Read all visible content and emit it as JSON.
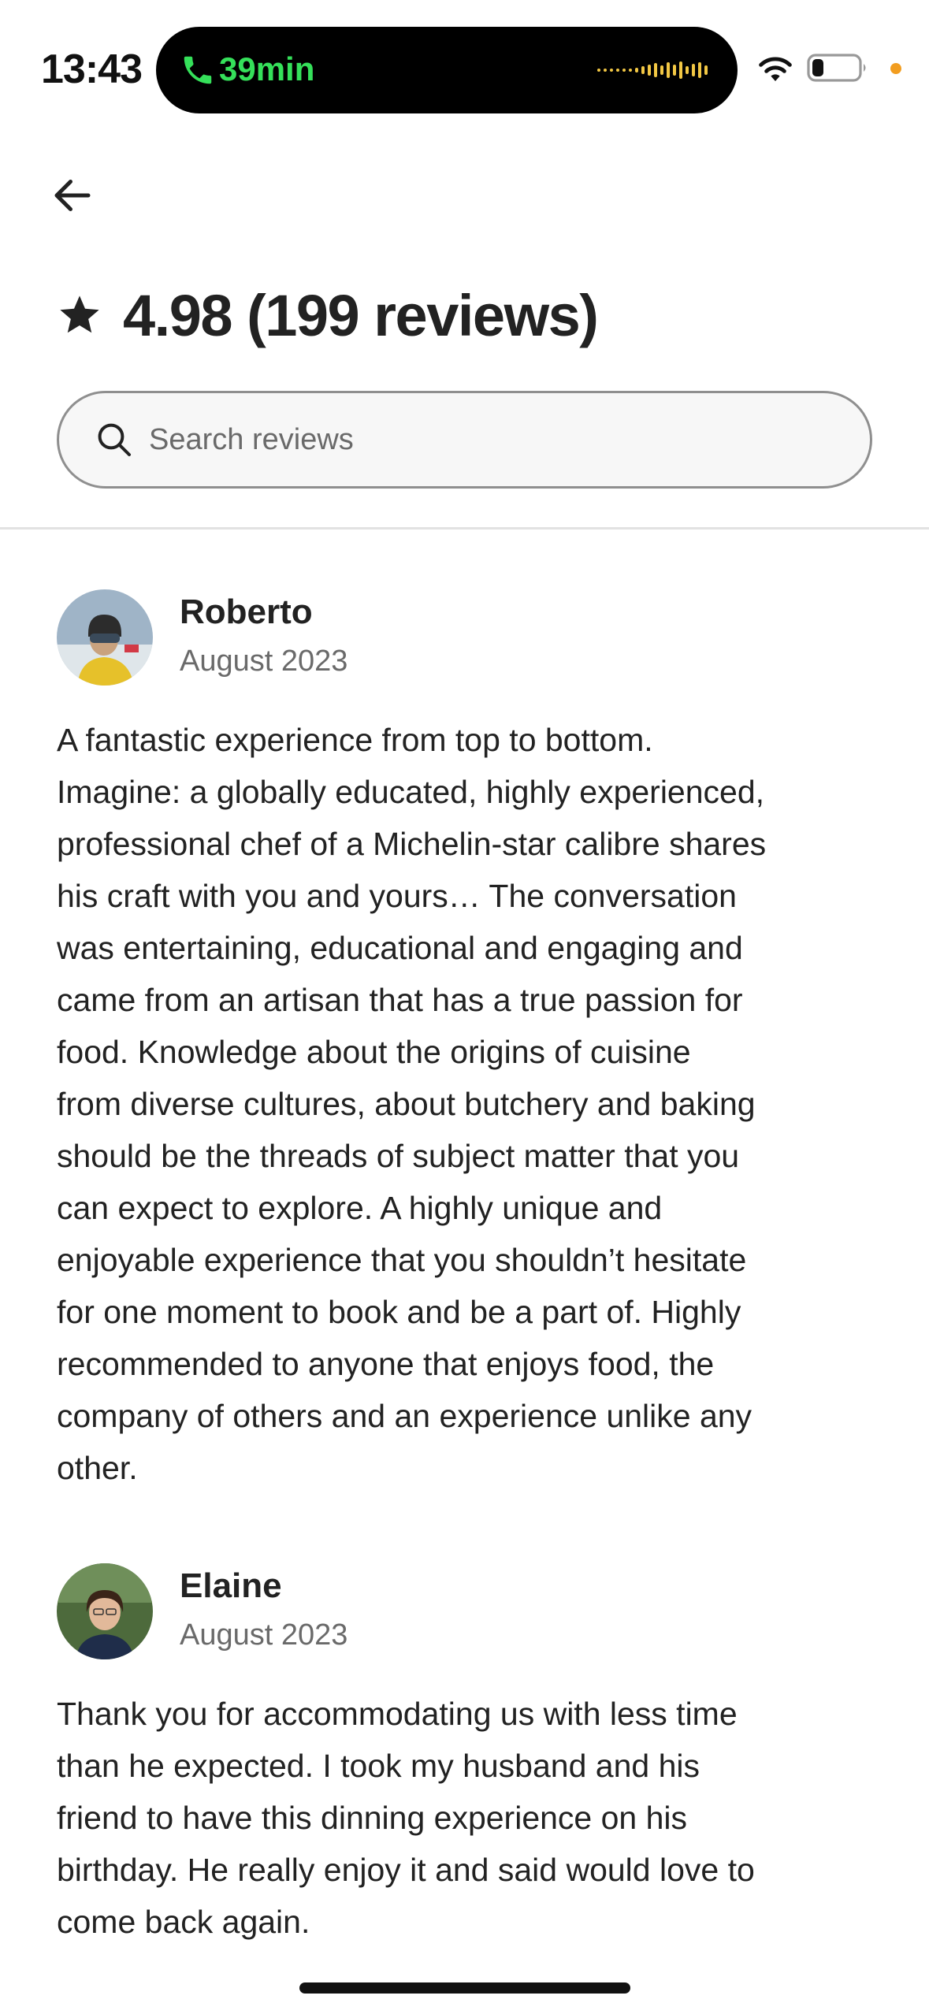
{
  "status_bar": {
    "time": "13:43",
    "call_duration": "39min",
    "icons": [
      "phone-icon",
      "waveform-icon",
      "wifi-icon",
      "battery-icon",
      "orange-dot-indicator"
    ],
    "colors": {
      "call": "#35e05a",
      "waveform": "#f2c744",
      "indicator": "#f29d1f"
    }
  },
  "header": {
    "back_icon": "arrow-left-icon",
    "star_icon": "star-icon",
    "rating_title": "4.98 (199 reviews)"
  },
  "search": {
    "icon": "search-icon",
    "placeholder": "Search reviews",
    "value": ""
  },
  "reviews": [
    {
      "name": "Roberto",
      "date": "August 2023",
      "text": "A fantastic experience from top to bottom.\nImagine: a globally educated, highly experienced,\nprofessional chef of a Michelin-star calibre shares\nhis craft with you and yours… The conversation\nwas entertaining, educational and engaging and\ncame from an artisan that has a true passion for\nfood. Knowledge about the origins of cuisine\nfrom diverse cultures, about butchery and baking\nshould be the threads of subject matter that you\ncan expect to explore. A highly unique and\nenjoyable experience that you shouldn’t hesitate\nfor one moment to book and be a part of. Highly\nrecommended to anyone that enjoys food, the\ncompany of others and an experience unlike any\nother."
    },
    {
      "name": "Elaine",
      "date": "August 2023",
      "text": "Thank you for accommodating us with less time\nthan he expected. I took my husband and his\nfriend to have this dinning experience on his\nbirthday. He really enjoy it and said would love to\ncome back again."
    }
  ]
}
